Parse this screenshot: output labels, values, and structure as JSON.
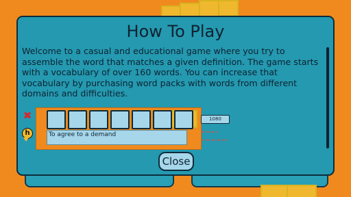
{
  "modal": {
    "title": "How To Play",
    "description": "Welcome to a casual and educational game where you try to assemble the word that matches a given definition.  The game starts with a vocabulary of over 160 words.  You can increase that vocabulary by purchasing word packs with words from different domains and difficulties.",
    "close_label": "Close"
  },
  "demo": {
    "definition_text": "To agree to a demand",
    "score": "1080",
    "slot_count": 7,
    "hint_icon_letter": "h",
    "wrong_icon": "✖"
  },
  "colors": {
    "background": "#f08a1e",
    "modal": "#2499b0",
    "slot": "#a6d6ea",
    "accent_red": "#d8262a",
    "tile_yellow": "#f0b82e"
  },
  "icons": [
    "close-x-icon",
    "hint-h-icon"
  ]
}
